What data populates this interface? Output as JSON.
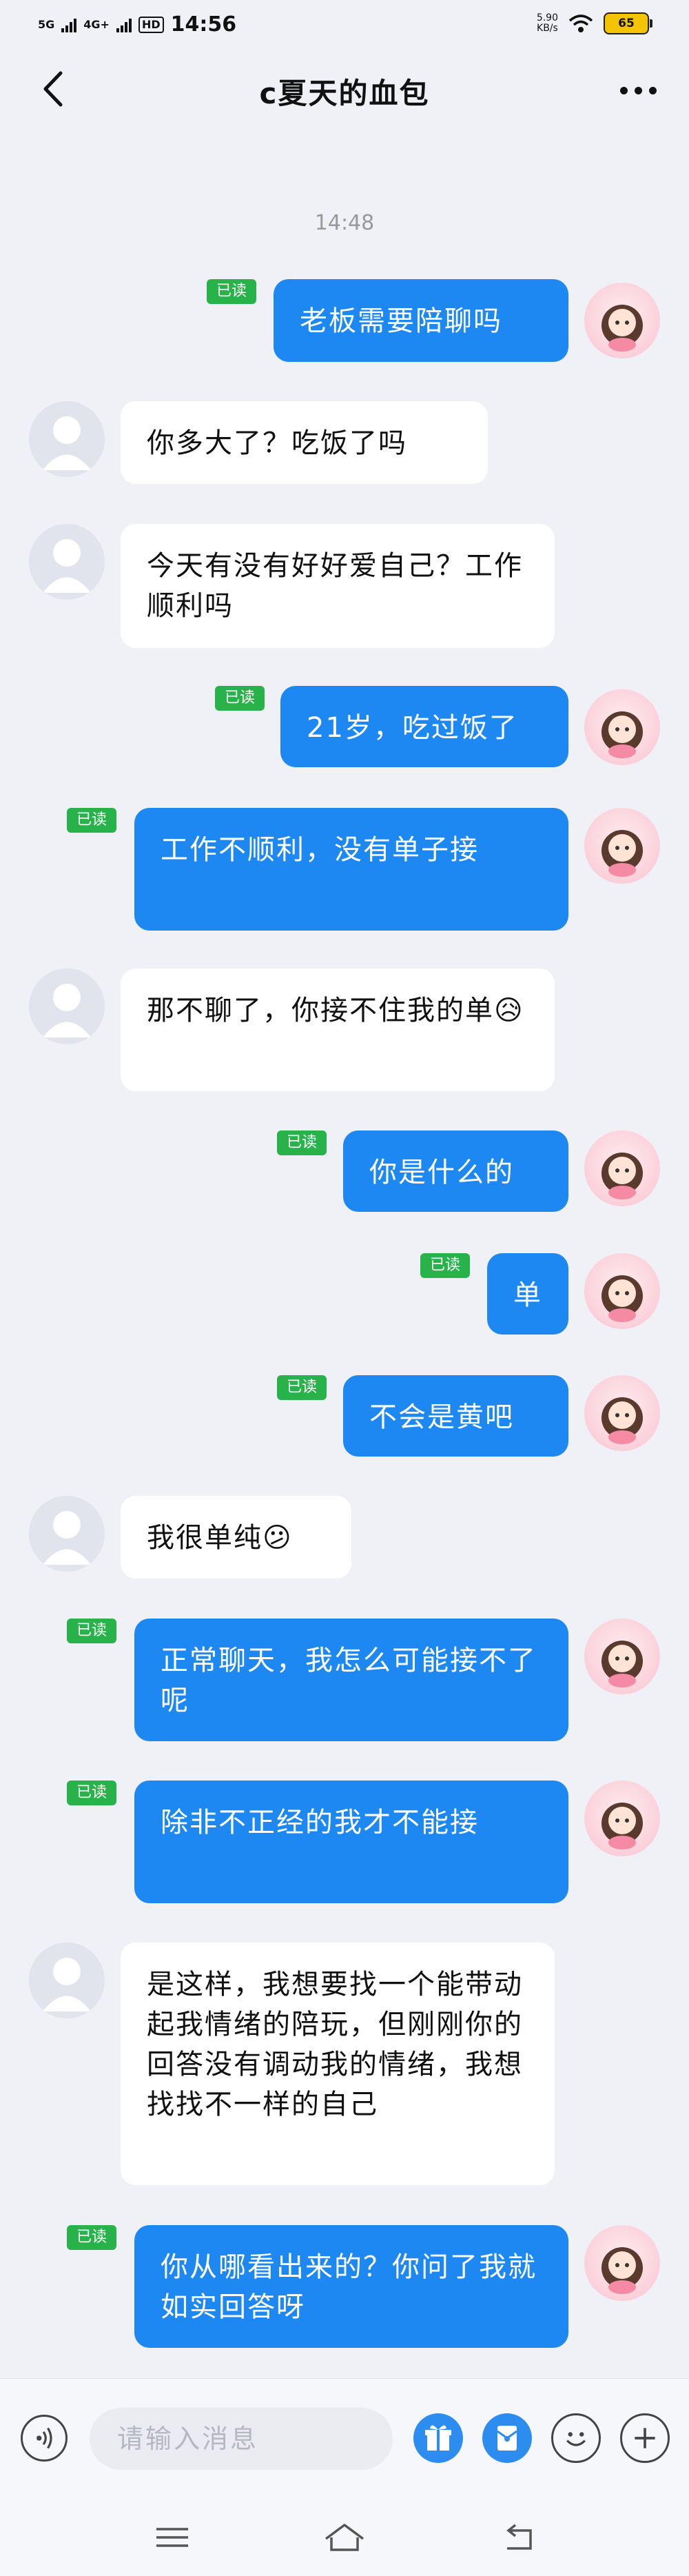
{
  "status_bar": {
    "network_1": "5G",
    "network_2": "4G+",
    "hd": "HD",
    "time": "14:56",
    "speed_value": "5.90",
    "speed_unit": "KB/s",
    "battery": "65"
  },
  "header": {
    "title": "c夏天的血包"
  },
  "chat": {
    "timestamp": "14:48",
    "messages": [
      {
        "side": "right",
        "text": "老板需要陪聊吗",
        "read": "已读"
      },
      {
        "side": "left",
        "text": "你多大了？吃饭了吗"
      },
      {
        "side": "left",
        "text": "今天有没有好好爱自己？工作顺利吗"
      },
      {
        "side": "right",
        "text": "21岁，吃过饭了",
        "read": "已读"
      },
      {
        "side": "right",
        "text": "工作不顺利，没有单子接",
        "read": "已读"
      },
      {
        "side": "left",
        "text": "那不聊了，你接不住我的单😥"
      },
      {
        "side": "right",
        "text": "你是什么的",
        "read": "已读"
      },
      {
        "side": "right",
        "text": "单",
        "read": "已读"
      },
      {
        "side": "right",
        "text": "不会是黄吧",
        "read": "已读"
      },
      {
        "side": "left",
        "text": "我很单纯😕"
      },
      {
        "side": "right",
        "text": "正常聊天，我怎么可能接不了呢",
        "read": "已读"
      },
      {
        "side": "right",
        "text": "除非不正经的我才不能接",
        "read": "已读"
      },
      {
        "side": "left",
        "text": "是这样，我想要找一个能带动起我情绪的陪玩，但刚刚你的回答没有调动我的情绪，我想找找不一样的自己"
      },
      {
        "side": "right",
        "text": "你从哪看出来的？你问了我就如实回答呀",
        "read": "已读"
      }
    ]
  },
  "input_bar": {
    "placeholder": "请输入消息"
  },
  "icons": {
    "back": "back-arrow-icon",
    "more": "more-dots-icon",
    "voice": "voice-icon",
    "gift": "gift-icon",
    "red_packet": "red-packet-icon",
    "emoji": "emoji-icon",
    "plus": "plus-icon"
  },
  "colors": {
    "bubble_outgoing": "#1e88f2",
    "bubble_incoming": "#ffffff",
    "read_badge": "#27b34a",
    "background": "#eff1f6"
  }
}
